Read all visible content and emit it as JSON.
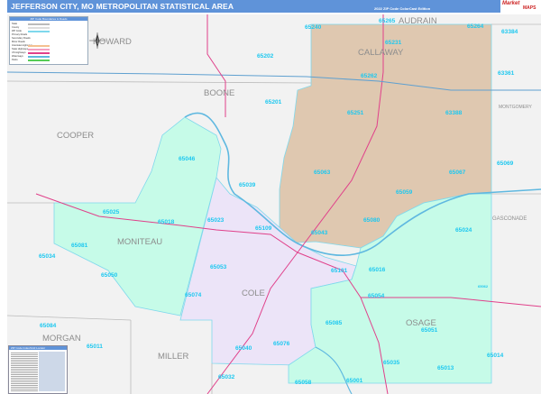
{
  "header": {
    "title": "JEFFERSON CITY, MO METROPOLITAN STATISTICAL AREA",
    "edition": "2022 ZIP Code ColorCast Edition",
    "logo": "Market Maps"
  },
  "colors": {
    "header": "#5f93d9",
    "callaway": "#dfc8b0",
    "moniteau_osage": "#c6fbe8",
    "cole": "#ece4f8",
    "zip_label": "#1ec8f0",
    "county_label": "#8d8d8d",
    "highway": "#e0408a",
    "zip_boundary": "#7fd8ec",
    "river": "#5fb8e0"
  },
  "legend": {
    "title": "ZIP Code Boundaries & Roads",
    "items": [
      "State",
      "County",
      "ZIP Code",
      "Primary Roads",
      "Secondary Roads",
      "Minor Roads",
      "Interstate Highways",
      "State Highways",
      "US Highways",
      "Waterways",
      "Parks"
    ]
  },
  "index": {
    "title": "ZIP Code Index/Grid Locator"
  },
  "compass": "north-arrow-icon",
  "counties": [
    "HOWARD",
    "BOONE",
    "COOPER",
    "MONITEAU",
    "COLE",
    "MILLER",
    "MORGAN",
    "OSAGE",
    "CALLAWAY",
    "AUDRAIN",
    "MONTGOMERY",
    "GASCONADE"
  ],
  "zips": [
    "65240",
    "65265",
    "65264",
    "63384",
    "65231",
    "65202",
    "65262",
    "63361",
    "65201",
    "65251",
    "63388",
    "65039",
    "65046",
    "65063",
    "65067",
    "65069",
    "65059",
    "65025",
    "65018",
    "65023",
    "65109",
    "65080",
    "65024",
    "65043",
    "65081",
    "65034",
    "65053",
    "65101",
    "65016",
    "65050",
    "65074",
    "65054",
    "65062",
    "65084",
    "65085",
    "65051",
    "65011",
    "65040",
    "65076",
    "65035",
    "65013",
    "65014",
    "65032",
    "65058",
    "65001"
  ]
}
